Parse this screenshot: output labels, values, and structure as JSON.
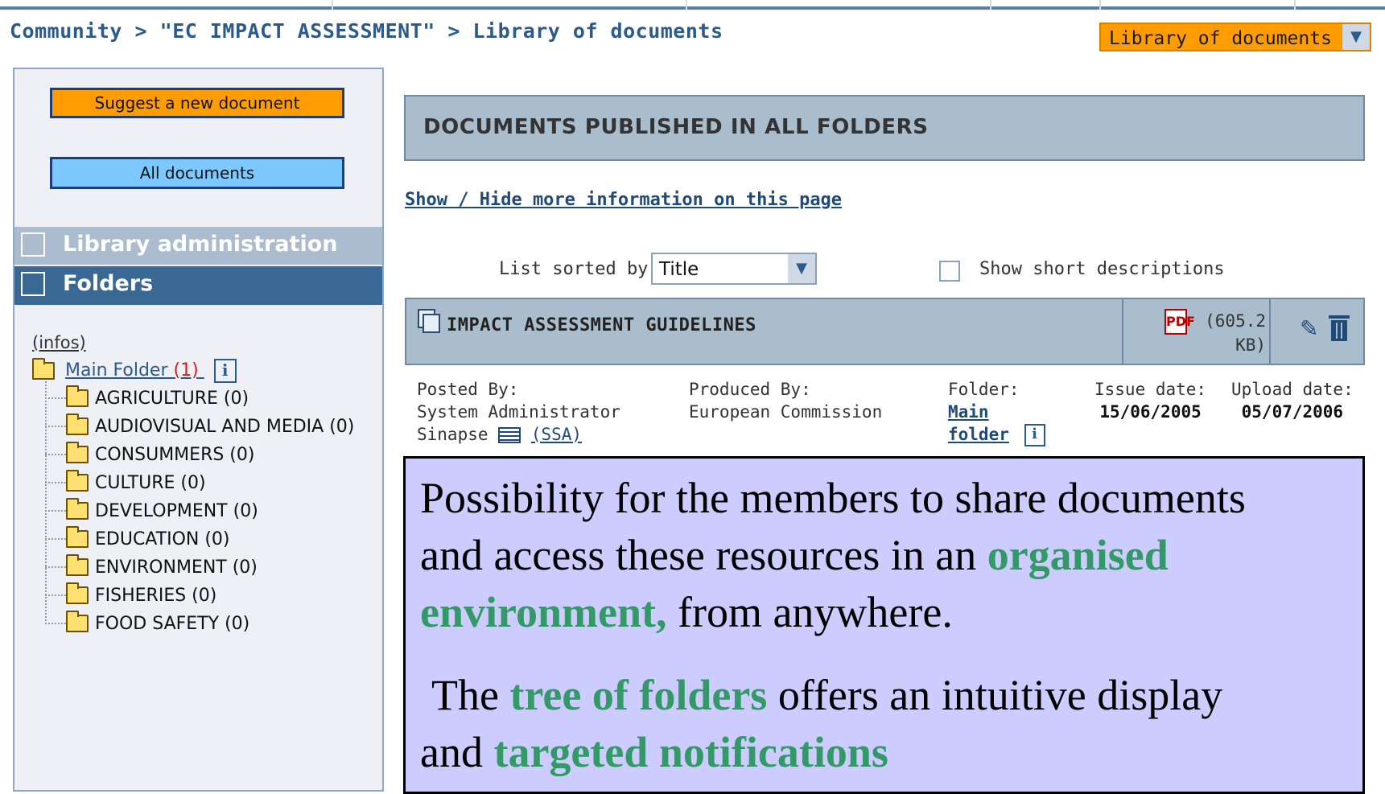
{
  "breadcrumb": {
    "community": "Community",
    "separator": ">",
    "group": "\"EC IMPACT ASSESSMENT\"",
    "current": "Library of documents"
  },
  "section_select": {
    "value": "Library of documents"
  },
  "sidebar": {
    "suggest_button": "Suggest a new document",
    "all_documents_button": "All documents",
    "nav_admin": "Library administration",
    "nav_folders": "Folders",
    "infos_link": "(infos)",
    "main_folder": {
      "label": "Main Folder",
      "count": "(1)"
    },
    "folders": [
      "AGRICULTURE (0)",
      "AUDIOVISUAL AND MEDIA (0)",
      "CONSUMMERS (0)",
      "CULTURE (0)",
      "DEVELOPMENT (0)",
      "EDUCATION (0)",
      "ENVIRONMENT (0)",
      "FISHERIES (0)",
      "FOOD SAFETY (0)"
    ]
  },
  "main": {
    "header": "DOCUMENTS PUBLISHED IN ALL FOLDERS",
    "show_hide": "Show / Hide more information on this page",
    "sort_label": "List sorted by:",
    "sort_value": "Title",
    "short_desc_label": "Show short descriptions",
    "document": {
      "title": "IMPACT ASSESSMENT GUIDELINES",
      "pdf_label": "PDF",
      "size_line1": "(605.2",
      "size_line2": "KB)",
      "posted_by_label": "Posted By:",
      "posted_by_line1": "System Administrator",
      "posted_by_line2": "Sinapse",
      "posted_by_tag": "(SSA)",
      "produced_by_label": "Produced By:",
      "produced_by": "European Commission",
      "folder_label": "Folder:",
      "folder_line1": "Main",
      "folder_line2": "folder",
      "issue_label": "Issue date:",
      "issue_value": "15/06/2005",
      "upload_label": "Upload date:",
      "upload_value": "05/07/2006"
    }
  },
  "callout": {
    "p1_a": "Possibility for the members to share documents",
    "p1_b": "and access these resources in an ",
    "p1_hl1": "organised",
    "p1_hl2": "environment,",
    "p1_c": " from anywhere.",
    "p2_a": "The ",
    "p2_hl1": "tree of folders",
    "p2_b": " offers an intuitive display",
    "p2_c": "and ",
    "p2_hl2": "targeted notifications"
  },
  "colors": {
    "accent_orange": "#ff9c00",
    "accent_blue": "#7cc8ff",
    "nav_active": "#3a6894",
    "callout_bg": "#ccccff",
    "highlight_green": "#339966"
  }
}
